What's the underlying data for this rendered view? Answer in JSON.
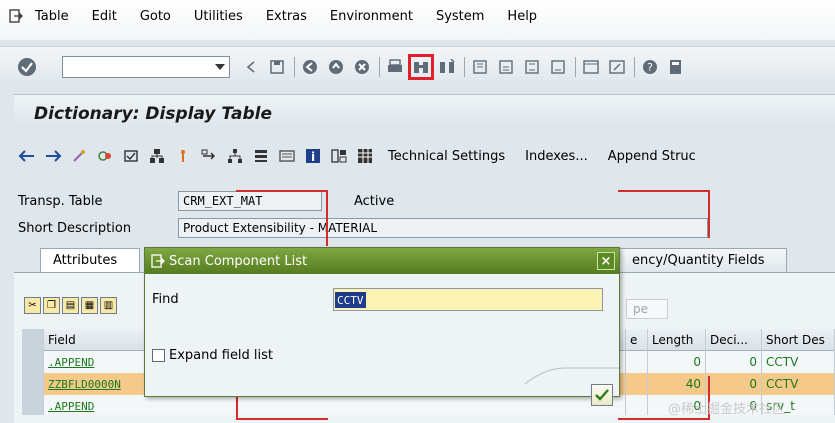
{
  "menubar": {
    "items": [
      {
        "label": "Table",
        "ul": ""
      },
      {
        "label": "Edit",
        "ul": ""
      },
      {
        "label": "Goto",
        "ul": ""
      },
      {
        "label": "Utilities",
        "ul": ""
      },
      {
        "label": "Extras",
        "ul": ""
      },
      {
        "label": "Environment",
        "ul": ""
      },
      {
        "label": "System",
        "ul": ""
      },
      {
        "label": "Help",
        "ul": ""
      }
    ]
  },
  "toolbar": {
    "command_value": "",
    "icons": [
      "back-icon",
      "save-icon",
      "back-nav-icon",
      "exit-icon",
      "cancel-icon",
      "print-icon",
      "find-icon",
      "find-next-icon",
      "first-page-icon",
      "prev-page-icon",
      "next-page-icon",
      "last-page-icon",
      "new-session-icon",
      "shortcut-icon",
      "help-icon",
      "layout-icon"
    ]
  },
  "title": "Dictionary: Display Table",
  "apptoolbar": {
    "buttons": [
      "Technical Settings",
      "Indexes...",
      "Append Struc"
    ]
  },
  "fields": {
    "table_label": "Transp. Table",
    "table_value": "CRM_EXT_MAT",
    "status": "Active",
    "desc_label": "Short Description",
    "desc_value": "Product Extensibility - MATERIAL"
  },
  "tabs": {
    "attributes": "Attributes",
    "currency": "ency/Quantity Fields"
  },
  "grid": {
    "ghost_button": "pe",
    "headers": {
      "field": "Field",
      "e": "e",
      "length": "Length",
      "dec": "Deci...",
      "desc": "Short Des"
    },
    "rows": [
      {
        "field": ".APPEND",
        "length": "0",
        "dec": "0",
        "desc": "CCTV"
      },
      {
        "field": "ZZBFLD0000N",
        "length": "40",
        "dec": "0",
        "desc": "CCTV"
      },
      {
        "field": ".APPEND",
        "length": "0",
        "dec": "0",
        "desc": "srv_t"
      }
    ]
  },
  "dialog": {
    "title": "Scan Component List",
    "find_label": "Find",
    "find_value": "CCTV",
    "expand_label": "Expand field list"
  },
  "watermark": "@稀土掘金技术社区",
  "colors": {
    "accent_red": "#d42b2b",
    "dialog_green": "#557b1e",
    "highlight_row": "#f5c98a"
  }
}
